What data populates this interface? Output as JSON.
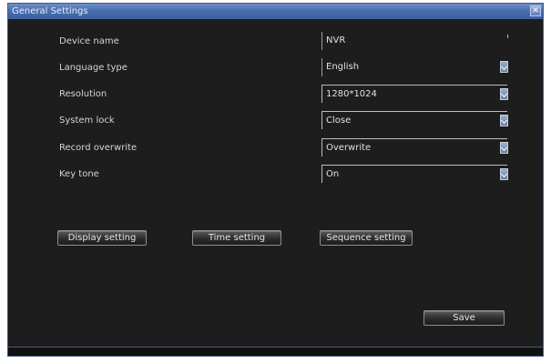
{
  "window": {
    "title": "General Settings",
    "close_glyph": "✕"
  },
  "settings": [
    {
      "label": "Device name",
      "value": "NVR",
      "type": "text"
    },
    {
      "label": "Language type",
      "value": "English",
      "type": "dropdown"
    },
    {
      "label": "Resolution",
      "value": "1280*1024",
      "type": "dropdown"
    },
    {
      "label": "System lock",
      "value": "Close",
      "type": "dropdown"
    },
    {
      "label": "Record overwrite",
      "value": "Overwrite",
      "type": "dropdown"
    },
    {
      "label": "Key tone",
      "value": "On",
      "type": "dropdown"
    }
  ],
  "buttons": {
    "display_setting": "Display setting",
    "time_setting": "Time setting",
    "sequence_setting": "Sequence setting",
    "save": "Save"
  },
  "colors": {
    "title_bar": "#4a6fb0",
    "background": "#1d1d1d",
    "text": "#d4d4d4"
  }
}
